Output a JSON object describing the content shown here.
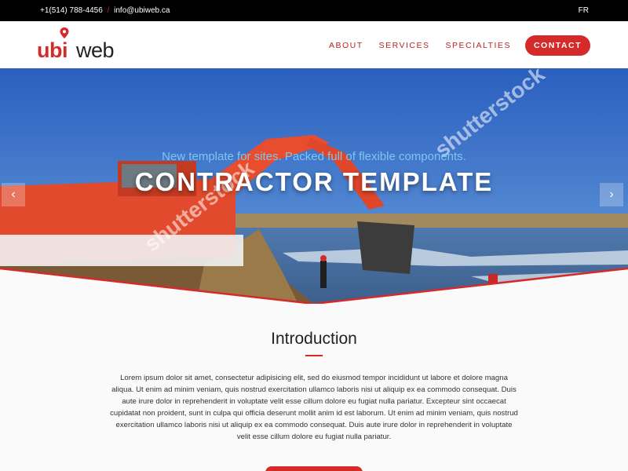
{
  "topbar": {
    "phone": "+1(514) 788-4456",
    "separator": "/",
    "email": "info@ubiweb.ca",
    "lang": "FR"
  },
  "logo": {
    "part1": "ubi",
    "part2": "web",
    "color": "#d42a2a"
  },
  "nav": {
    "items": [
      {
        "label": "ABOUT"
      },
      {
        "label": "SERVICES"
      },
      {
        "label": "SPECIALTIES"
      }
    ],
    "cta": "CONTACT"
  },
  "hero": {
    "subtitle": "New template for sites. Packed full of flexible components.",
    "title": "CONTRACTOR TEMPLATE",
    "prev_icon": "chevron-left-icon",
    "next_icon": "chevron-right-icon",
    "watermark": "shutterstock"
  },
  "intro": {
    "title": "Introduction",
    "text": "Lorem ipsum dolor sit amet, consectetur adipisicing elit, sed do eiusmod tempor incididunt ut labore et dolore magna aliqua. Ut enim ad minim veniam, quis nostrud exercitation ullamco laboris nisi ut aliquip ex ea commodo consequat. Duis aute irure dolor in reprehenderit in voluptate velit esse cillum dolore eu fugiat nulla pariatur. Excepteur sint occaecat cupidatat non proident, sunt in culpa qui officia deserunt mollit anim id est laborum. Ut enim ad minim veniam, quis nostrud exercitation ullamco laboris nisi ut aliquip ex ea commodo consequat. Duis aute irure dolor in reprehenderit in voluptate velit esse cillum dolore eu fugiat nulla pariatur."
  },
  "colors": {
    "accent": "#d42a2a",
    "topbar": "#000000",
    "sky": "#2f6bc4"
  }
}
